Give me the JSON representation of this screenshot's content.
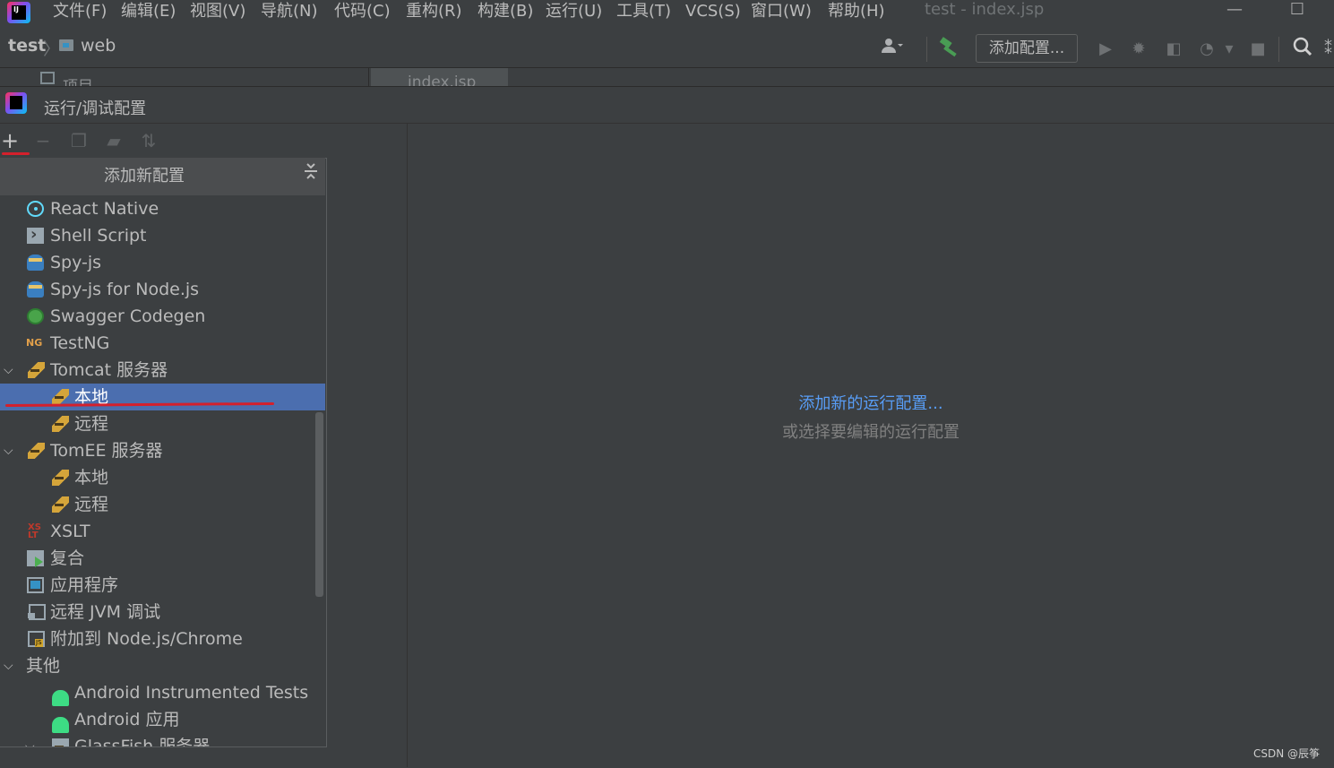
{
  "menubar": {
    "items": [
      "文件(F)",
      "编辑(E)",
      "视图(V)",
      "导航(N)",
      "代码(C)",
      "重构(R)",
      "构建(B)",
      "运行(U)",
      "工具(T)",
      "VCS(S)",
      "窗口(W)",
      "帮助(H)"
    ],
    "window_title": "test - index.jsp",
    "minimize": "—",
    "maximize": "☐"
  },
  "navbar": {
    "project": "test",
    "folder": "web",
    "add_config_label": "添加配置...",
    "icons": [
      "user-icon",
      "build-hammer-icon",
      "run-icon",
      "debug-icon",
      "coverage-icon",
      "profile-icon",
      "stop-icon",
      "search-icon"
    ]
  },
  "tabstrip": {
    "project_tab": "项目",
    "editor_tab": "index.jsp"
  },
  "dialog": {
    "title": "运行/调试配置",
    "toolbar_icons": [
      "add-icon",
      "remove-icon",
      "copy-icon",
      "new-folder-icon",
      "sort-icon"
    ],
    "empty": {
      "link": "添加新的运行配置...",
      "hint": "或选择要编辑的运行配置"
    }
  },
  "popup": {
    "title": "添加新配置",
    "items": [
      {
        "label": "React Native",
        "icon": "react-icon"
      },
      {
        "label": "Shell Script",
        "icon": "shell-script-icon"
      },
      {
        "label": "Spy-js",
        "icon": "spy-js-icon"
      },
      {
        "label": "Spy-js for Node.js",
        "icon": "spy-js-node-icon"
      },
      {
        "label": "Swagger Codegen",
        "icon": "swagger-icon"
      },
      {
        "label": "TestNG",
        "icon": "testng-icon"
      },
      {
        "label": "Tomcat 服务器",
        "icon": "tomcat-icon",
        "expanded": true
      },
      {
        "label": "本地",
        "icon": "tomcat-icon",
        "selected": true
      },
      {
        "label": "远程",
        "icon": "tomcat-icon"
      },
      {
        "label": "TomEE 服务器",
        "icon": "tomcat-icon",
        "expanded": true
      },
      {
        "label": "本地",
        "icon": "tomcat-icon"
      },
      {
        "label": "远程",
        "icon": "tomcat-icon"
      },
      {
        "label": "XSLT",
        "icon": "xslt-icon"
      },
      {
        "label": "复合",
        "icon": "compound-icon"
      },
      {
        "label": "应用程序",
        "icon": "application-icon"
      },
      {
        "label": "远程 JVM 调试",
        "icon": "remote-jvm-icon"
      },
      {
        "label": "附加到 Node.js/Chrome",
        "icon": "attach-node-icon"
      },
      {
        "label": "其他",
        "expanded": true
      },
      {
        "label": "Android Instrumented Tests",
        "icon": "android-icon"
      },
      {
        "label": "Android 应用",
        "icon": "android-icon"
      },
      {
        "label": "GlassFish 服务器",
        "icon": "glassfish-icon",
        "expanded": true
      }
    ]
  },
  "watermark": "CSDN @辰筝",
  "colors": {
    "background": "#3c3f41",
    "selection": "#4b6eaf",
    "link": "#589df6",
    "annotation_red": "#d4202c",
    "build_green": "#499c54"
  }
}
